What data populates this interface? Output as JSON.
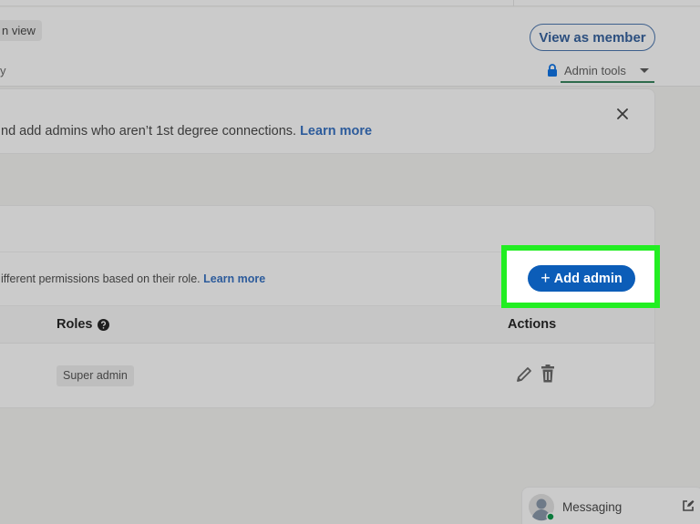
{
  "header": {
    "view_chip_label": "n view",
    "nav_partial_label": "y",
    "view_as_member_label": "View as member",
    "admin_tools_label": "Admin tools"
  },
  "banner": {
    "text": "nd add admins who aren’t 1st degree connections.",
    "link_label": "Learn more"
  },
  "admins_card": {
    "description": "ifferent permissions based on their role.",
    "link_label": "Learn more",
    "add_admin_label": "Add admin",
    "columns": [
      "Roles",
      "Actions"
    ],
    "rows": [
      {
        "role": "Super admin"
      }
    ]
  },
  "messaging": {
    "label": "Messaging",
    "status": "online"
  },
  "colors": {
    "primary_blue": "#0c5db8",
    "link_blue": "#2c5b9b",
    "highlight_green": "#22ee22",
    "online_green": "#0a7a3c",
    "tab_underline": "#2e6b4c"
  }
}
